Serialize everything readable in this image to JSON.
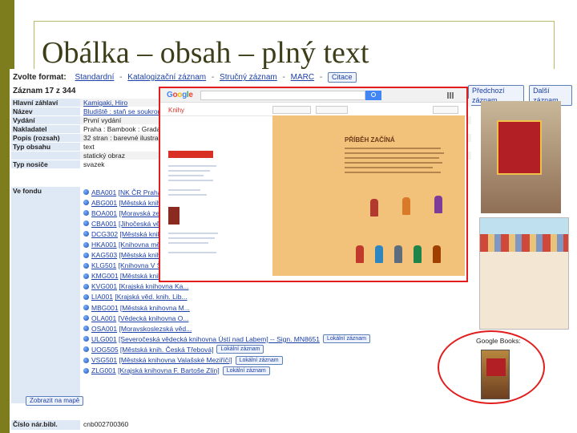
{
  "slide": {
    "title": "Obálka – obsah – plný text"
  },
  "format_bar": {
    "label": "Zvolte format:",
    "options": [
      "Standardní",
      "Katalogizační záznam",
      "Stručný záznam",
      "MARC"
    ],
    "separator": "-",
    "cite_button": "Citace"
  },
  "record_count": "Záznam 17 z 344",
  "navigation": {
    "previous": "Předchozí záznam",
    "next": "Další záznam"
  },
  "record": [
    {
      "label": "Hlavní záhlaví",
      "value": "Kamigaki, Hiro"
    },
    {
      "label": "Název",
      "value": "Bludiště : staň se soukromým detektivem : najdi ukradený bludný kámen / Hiro Kamigaki a IC4DESIGN"
    },
    {
      "label": "Vydání",
      "value": "První vydání"
    },
    {
      "label": "Nakladatel",
      "value": "Praha : Bambook : Grada, 2015"
    },
    {
      "label": "Popis (rozsah)",
      "value": "32 stran : barevné ilustrace ; 32 cm"
    },
    {
      "label": "Typ obsahu",
      "value": "text"
    },
    {
      "label": "",
      "value": "statický obraz"
    },
    {
      "label": "Typ nosiče",
      "value": "svazek"
    }
  ],
  "holdings": {
    "label": "Ve fondu",
    "items": [
      {
        "code": "ABA001",
        "text": "[NK ČR Praha] -- pro..."
      },
      {
        "code": "ABG001",
        "text": "[Městská knihovna P..."
      },
      {
        "code": "BOA001",
        "text": "[Moravská zemská kn..."
      },
      {
        "code": "CBA001",
        "text": "[Jihočeská vědecká kn..."
      },
      {
        "code": "DCG302",
        "text": "[Městská knih. Děčín..."
      },
      {
        "code": "HKA001",
        "text": "[Knihovna města Hr..."
      },
      {
        "code": "KAG503",
        "text": "[Městská knih. Havíř..."
      },
      {
        "code": "KLG501",
        "text": "[Knihovna V Štecha S..."
      },
      {
        "code": "KMG001",
        "text": "[Městská knihovna K..."
      },
      {
        "code": "KVG001",
        "text": "[Krajská knihovna Ka..."
      },
      {
        "code": "LIA001",
        "text": "[Krajská věd. knih. Lib..."
      },
      {
        "code": "MBG001",
        "text": "[Městská knihovna M..."
      },
      {
        "code": "OLA001",
        "text": "[Vědecká knihovna O..."
      },
      {
        "code": "OSA001",
        "text": "[Moravskoslezská věd..."
      },
      {
        "code": "ULG001",
        "text": "[Severočeská vědecká knihovna Ústí nad Labem] -- Sign. MN8651",
        "button": "Lokální záznam"
      },
      {
        "code": "UOG505",
        "text": "[Městská knih. Česká Třebová]",
        "button": "Lokální záznam"
      },
      {
        "code": "VSG501",
        "text": "[Městská knihovna Valašské Meziříčí]",
        "button": "Lokální záznam"
      },
      {
        "code": "ZLG001",
        "text": "[Krajská knihovna F. Bartoše Zlín]",
        "button": "Lokální záznam"
      }
    ],
    "map_button": "Zobrazit na mapě"
  },
  "cnb": {
    "label": "Číslo nár.bibl.",
    "value": "cnb002700360"
  },
  "google_books": {
    "label": "Google Books:",
    "logo": "Google",
    "section": "Knihy",
    "page_heading": "PŘÍBĚH ZAČÍNÁ"
  },
  "colors": {
    "slide_bar": "#7d7d1e",
    "highlight": "#e11d1d",
    "link": "#1b3fa8",
    "label_bg": "#dfe8f5"
  }
}
